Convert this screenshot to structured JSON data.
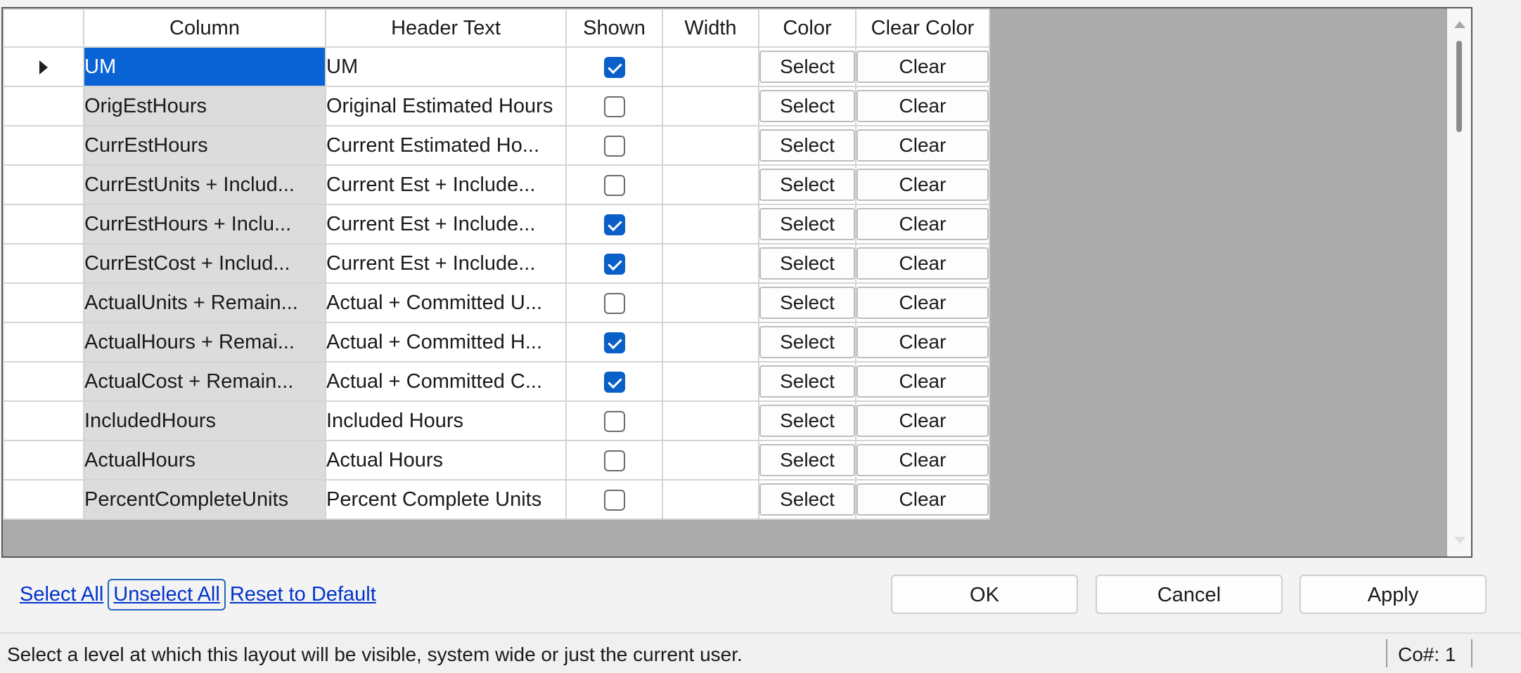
{
  "grid": {
    "columns": [
      "Column",
      "Header Text",
      "Shown",
      "Width",
      "Color",
      "Clear Color"
    ],
    "rows": [
      {
        "column": "UM",
        "header": "UM",
        "shown": true,
        "width": "",
        "select": "Select",
        "clear": "Clear"
      },
      {
        "column": "OrigEstHours",
        "header": "Original Estimated Hours",
        "shown": false,
        "width": "",
        "select": "Select",
        "clear": "Clear"
      },
      {
        "column": "CurrEstHours",
        "header": "Current Estimated Ho...",
        "shown": false,
        "width": "",
        "select": "Select",
        "clear": "Clear"
      },
      {
        "column": "CurrEstUnits + Includ...",
        "header": "Current Est + Include...",
        "shown": false,
        "width": "",
        "select": "Select",
        "clear": "Clear"
      },
      {
        "column": "CurrEstHours + Inclu...",
        "header": "Current Est + Include...",
        "shown": true,
        "width": "",
        "select": "Select",
        "clear": "Clear"
      },
      {
        "column": "CurrEstCost + Includ...",
        "header": "Current Est + Include...",
        "shown": true,
        "width": "",
        "select": "Select",
        "clear": "Clear"
      },
      {
        "column": "ActualUnits + Remain...",
        "header": "Actual + Committed U...",
        "shown": false,
        "width": "",
        "select": "Select",
        "clear": "Clear"
      },
      {
        "column": "ActualHours + Remai...",
        "header": "Actual + Committed H...",
        "shown": true,
        "width": "",
        "select": "Select",
        "clear": "Clear"
      },
      {
        "column": "ActualCost + Remain...",
        "header": "Actual + Committed C...",
        "shown": true,
        "width": "",
        "select": "Select",
        "clear": "Clear"
      },
      {
        "column": "IncludedHours",
        "header": "Included Hours",
        "shown": false,
        "width": "",
        "select": "Select",
        "clear": "Clear"
      },
      {
        "column": "ActualHours",
        "header": "Actual Hours",
        "shown": false,
        "width": "",
        "select": "Select",
        "clear": "Clear"
      },
      {
        "column": "PercentCompleteUnits",
        "header": "Percent Complete Units",
        "shown": false,
        "width": "",
        "select": "Select",
        "clear": "Clear"
      }
    ]
  },
  "links": {
    "select_all": "Select All",
    "unselect_all": "Unselect All",
    "reset": "Reset to Default"
  },
  "buttons": {
    "ok": "OK",
    "cancel": "Cancel",
    "apply": "Apply"
  },
  "status": {
    "message": "Select a level at which this layout will be visible, system wide or just the current user.",
    "co": "Co#: 1"
  },
  "colors": {
    "selection": "#0a63d4",
    "checkbox_checked": "#0a5fc8",
    "grid_background": "#ababab",
    "link": "#0033cc"
  }
}
